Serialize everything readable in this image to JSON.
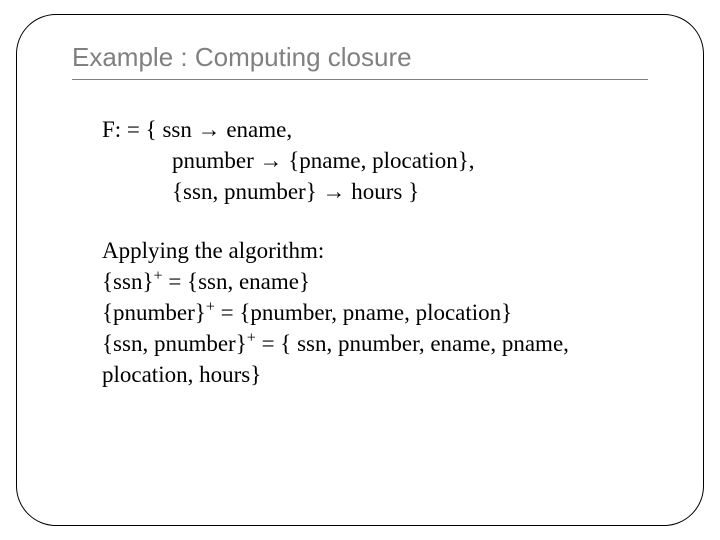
{
  "title": "Example : Computing closure",
  "fd": {
    "line1_a": "F: = { ssn ",
    "line1_b": " ename,",
    "line2_a": "pnumber ",
    "line2_b": " {pname, plocation},",
    "line3_a": "{ssn, pnumber} ",
    "line3_b": " hours }"
  },
  "alg": {
    "heading": "Applying the algorithm:",
    "r1_a": "{ssn}",
    "r1_b": " = {ssn, ename}",
    "r2_a": "{pnumber}",
    "r2_b": " = {pnumber, pname, plocation}",
    "r3_a": "{ssn, pnumber}",
    "r3_b": " = { ssn, pnumber, ename, pname, plocation,    hours}"
  },
  "symbols": {
    "arrow": "→",
    "plus": "+"
  }
}
